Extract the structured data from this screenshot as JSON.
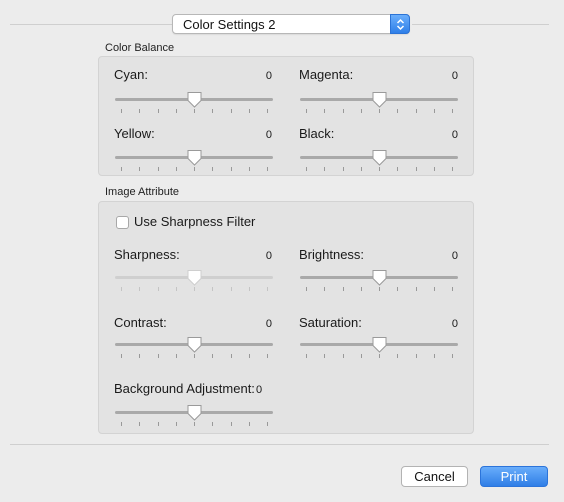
{
  "popup": {
    "selected": "Color Settings 2"
  },
  "color_balance": {
    "title": "Color Balance",
    "sliders": [
      {
        "id": "cyan",
        "label": "Cyan:",
        "value": "0",
        "position": 0.5
      },
      {
        "id": "magenta",
        "label": "Magenta:",
        "value": "0",
        "position": 0.5
      },
      {
        "id": "yellow",
        "label": "Yellow:",
        "value": "0",
        "position": 0.5
      },
      {
        "id": "black",
        "label": "Black:",
        "value": "0",
        "position": 0.5
      }
    ]
  },
  "image_attribute": {
    "title": "Image Attribute",
    "sharpness_filter": {
      "label": "Use Sharpness Filter",
      "checked": false
    },
    "sliders": [
      {
        "id": "sharpness",
        "label": "Sharpness:",
        "value": "0",
        "position": 0.5,
        "enabled": false
      },
      {
        "id": "brightness",
        "label": "Brightness:",
        "value": "0",
        "position": 0.5,
        "enabled": true
      },
      {
        "id": "contrast",
        "label": "Contrast:",
        "value": "0",
        "position": 0.5,
        "enabled": true
      },
      {
        "id": "saturation",
        "label": "Saturation:",
        "value": "0",
        "position": 0.5,
        "enabled": true
      },
      {
        "id": "background-adjustment",
        "label": "Background Adjustment:",
        "value": "0",
        "position": 0.5,
        "enabled": true
      }
    ]
  },
  "buttons": {
    "cancel": "Cancel",
    "print": "Print"
  },
  "colors": {
    "accent": "#2f7fe8"
  }
}
